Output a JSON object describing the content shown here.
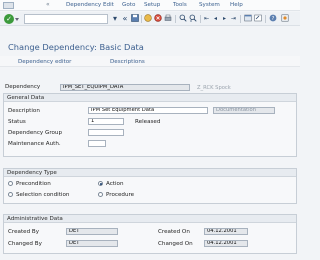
{
  "menubar": {
    "items": [
      "Dependency",
      "Edit",
      "Goto",
      "Setup",
      "Tools",
      "System",
      "Help"
    ]
  },
  "toolbar": {
    "command_value": "",
    "icons": [
      "check-icon",
      "dropdown-icon",
      "save-icon",
      "back-icon",
      "exit-icon",
      "cancel-icon",
      "print-icon",
      "find-icon",
      "find-next-icon",
      "first-page-icon",
      "previous-page-icon",
      "next-page-icon",
      "last-page-icon",
      "new-session-icon",
      "shortcut-icon",
      "help-icon",
      "customize-icon"
    ]
  },
  "title": "Change Dependency: Basic Data",
  "app_toolbar": {
    "dependency_editor": "Dependency editor",
    "descriptions": "Descriptions"
  },
  "header": {
    "dependency_label": "Dependency",
    "dependency_value": "IPM_SET_EQUIPM_DATA",
    "dependency_hint": "Z_RCK Spock"
  },
  "general": {
    "title": "General Data",
    "description_label": "Description",
    "description_value": "IPM Set Equipment Data",
    "description_button": "Documentation",
    "status_label": "Status",
    "status_value": "1",
    "status_text": "Released",
    "group_label": "Dependency Group",
    "group_value": "",
    "maint_label": "Maintenance Auth.",
    "maint_value": ""
  },
  "dependency_type": {
    "title": "Dependency Type",
    "options": [
      {
        "label": "Precondition",
        "selected": false
      },
      {
        "label": "Action",
        "selected": true
      },
      {
        "label": "Selection condition",
        "selected": false
      },
      {
        "label": "Procedure",
        "selected": false
      }
    ]
  },
  "admin": {
    "title": "Administrative Data",
    "created_by_label": "Created By",
    "created_by_value": "DET",
    "changed_by_label": "Changed By",
    "changed_by_value": "DET",
    "created_on_label": "Created On",
    "created_on_value": "04.12.2001",
    "changed_on_label": "Changed On",
    "changed_on_value": "04.12.2001"
  },
  "colors": {
    "accent": "#3c5f8f",
    "ok": "#3c9a3c"
  }
}
